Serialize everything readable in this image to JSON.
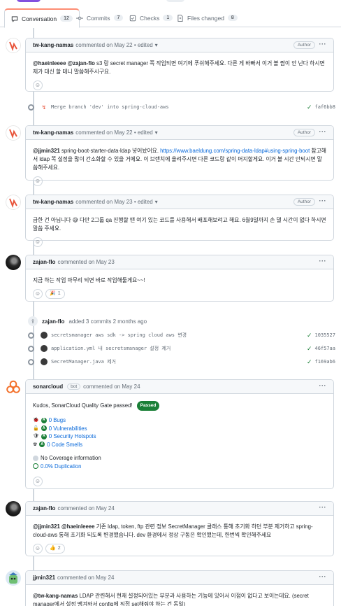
{
  "tabs": [
    {
      "label": "Conversation",
      "count": "12"
    },
    {
      "label": "Commits",
      "count": "7"
    },
    {
      "label": "Checks",
      "count": "1"
    },
    {
      "label": "Files changed",
      "count": "8"
    }
  ],
  "comments": [
    {
      "author": "tw-kang-namas",
      "meta": "commented on May 22 • edited",
      "badge": "Author",
      "body_mentions": "@haeinleeee @zajan-flo",
      "body": " s3 랑 secret manager 쪽 작업되면 여기에 푸쉬해주세요. 다른 게 바빠서 이거 볼 짬이 안 난다 하시면 제가 대신 할 테니 말씀해주시구요."
    },
    {
      "author": "tw-kang-namas",
      "meta": "commented on May 22 • edited",
      "badge": "Author",
      "body_mentions": "@jjmin321",
      "body_pre": " spring-boot-starter-data-ldap 넣어놨어요. ",
      "link": "https://www.baeldung.com/spring-data-ldap#using-spring-boot",
      "body_post": " 참고해서 ldap 쪽 설정을 많이 간소화할 수 있을 거에요. 이 브랜치에 올려주시면 다른 코드랑 같이 머지할게요. 이거 볼 시간 안되시면 말씀해주세요."
    },
    {
      "author": "tw-kang-namas",
      "meta": "commented on May 23 • edited",
      "badge": "Author",
      "body": "급한 건 아닙니다 😅 다만 2그룹 qa 진행할 땐 여기 있는 코드를 사용해서 배포해보려고 해요. 6월9일까지 손 댈 시간이 없다 하시면 말씀 주세요."
    },
    {
      "author": "zajan-flo",
      "meta": "commented on May 23",
      "body": "지금 하는 작업 마무리 되면 바로 작업해둘게요~~!",
      "reaction": "🎉",
      "reaction_count": "1"
    },
    {
      "author": "zajan-flo",
      "meta": "commented on May 24",
      "body_mentions": "@jjmin321 @haeinleeee",
      "body": " 기존 ldap, token, ftp 관련 정보 SecretManager 클래스 통해 초기화 하던 부분 제거하고 spring-cloud-aws 통해 초기화 되도록 변경했습니다. dev 환경에서 정상 구동은 확인했는데, 한번씩 확인해주세요",
      "reaction": "👍",
      "reaction_count": "2"
    },
    {
      "author": "jjmin321",
      "meta": "commented on May 24",
      "body_mentions": "@tw-kang-namas",
      "body": " LDAP 관련해서 현재 설정되어있는 부분과 사용하는 기능에 있어서 이점이 없다고 보이는데요. (secret manager에서 설정 땡겨와서 config에 직접 set해줘야 하는 건 동일)"
    }
  ],
  "merge_commit": {
    "message": "Merge branch 'dev' into spring-cloud-aws",
    "sha": "faf6bb8"
  },
  "added_event": {
    "author": "zajan-flo",
    "text": "added 3 commits 2 months ago"
  },
  "commits": [
    {
      "message": "secretsmanager aws sdk -> spring cloud aws 변경",
      "sha": "1035527"
    },
    {
      "message": "application.yml 내 secretsmanager 설정 제거",
      "sha": "46f57aa"
    },
    {
      "message": "SecretManager.java 제거",
      "sha": "f169ab6"
    }
  ],
  "sonar": {
    "author": "sonarcloud",
    "bot_label": "bot",
    "meta": "commented on May 24",
    "headline": "Kudos, SonarCloud Quality Gate passed!",
    "status": "Passed",
    "metrics": [
      "0 Bugs",
      "0 Vulnerabilities",
      "0 Security Hotspots",
      "0 Code Smells"
    ],
    "grade": "A",
    "coverage": "No Coverage information",
    "duplication": "0.0% Duplication"
  },
  "colors": {
    "accent": "#0969da",
    "success": "#1a7f37",
    "tab_active": "#fd8c73"
  }
}
